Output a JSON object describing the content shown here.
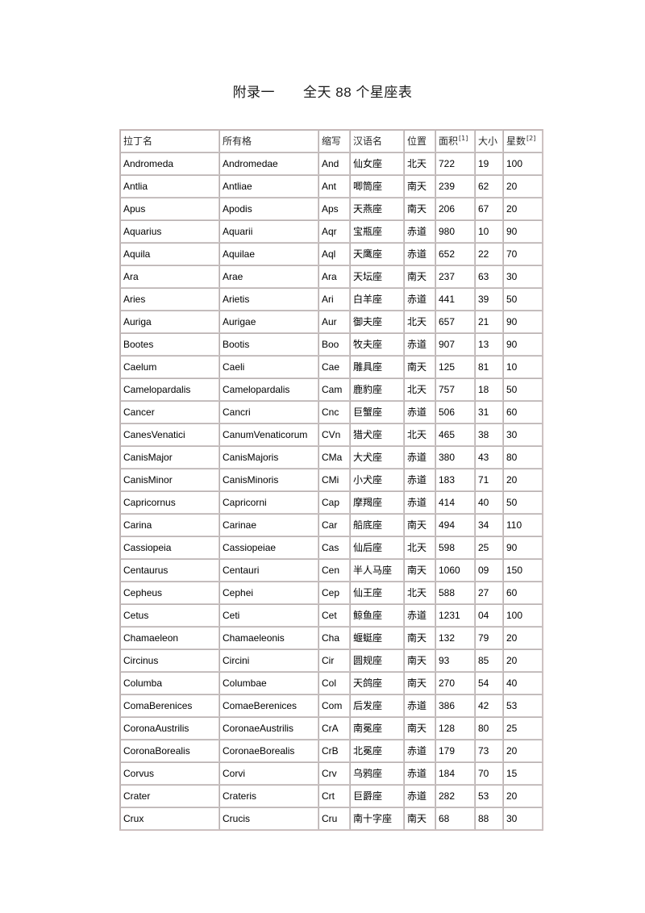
{
  "document": {
    "title": "附录一　　全天 88 个星座表",
    "page_background": "#ffffff",
    "border_color": "#b9b2b2"
  },
  "table": {
    "name": "全天88个星座表",
    "headers": [
      {
        "label": "拉丁名",
        "footnote": ""
      },
      {
        "label": "所有格",
        "footnote": ""
      },
      {
        "label": "缩写",
        "footnote": ""
      },
      {
        "label": "汉语名",
        "footnote": ""
      },
      {
        "label": "位置",
        "footnote": ""
      },
      {
        "label": "面积",
        "footnote": "[1]"
      },
      {
        "label": "大小",
        "footnote": ""
      },
      {
        "label": "星数",
        "footnote": "[2]"
      }
    ],
    "rows": [
      [
        "Andromeda",
        "Andromedae",
        "And",
        "仙女座",
        "北天",
        "722",
        "19",
        "100"
      ],
      [
        "Antlia",
        "Antliae",
        "Ant",
        "唧筒座",
        "南天",
        "239",
        "62",
        "20"
      ],
      [
        "Apus",
        "Apodis",
        "Aps",
        "天燕座",
        "南天",
        "206",
        "67",
        "20"
      ],
      [
        "Aquarius",
        "Aquarii",
        "Aqr",
        "宝瓶座",
        "赤道",
        "980",
        "10",
        "90"
      ],
      [
        "Aquila",
        "Aquilae",
        "Aql",
        "天鹰座",
        "赤道",
        "652",
        "22",
        "70"
      ],
      [
        "Ara",
        "Arae",
        "Ara",
        "天坛座",
        "南天",
        "237",
        "63",
        "30"
      ],
      [
        "Aries",
        "Arietis",
        "Ari",
        "白羊座",
        "赤道",
        "441",
        "39",
        "50"
      ],
      [
        "Auriga",
        "Aurigae",
        "Aur",
        "御夫座",
        "北天",
        "657",
        "21",
        "90"
      ],
      [
        "Bootes",
        "Bootis",
        "Boo",
        "牧夫座",
        "赤道",
        "907",
        "13",
        "90"
      ],
      [
        "Caelum",
        "Caeli",
        "Cae",
        "雕具座",
        "南天",
        "125",
        "81",
        "10"
      ],
      [
        "Camelopardalis",
        "Camelopardalis",
        "Cam",
        "鹿豹座",
        "北天",
        "757",
        "18",
        "50"
      ],
      [
        "Cancer",
        "Cancri",
        "Cnc",
        "巨蟹座",
        "赤道",
        "506",
        "31",
        "60"
      ],
      [
        "CanesVenatici",
        "CanumVenaticorum",
        "CVn",
        "猎犬座",
        "北天",
        "465",
        "38",
        "30"
      ],
      [
        "CanisMajor",
        "CanisMajoris",
        "CMa",
        "大犬座",
        "赤道",
        "380",
        "43",
        "80"
      ],
      [
        "CanisMinor",
        "CanisMinoris",
        "CMi",
        "小犬座",
        "赤道",
        "183",
        "71",
        "20"
      ],
      [
        "Capricornus",
        "Capricorni",
        "Cap",
        "摩羯座",
        "赤道",
        "414",
        "40",
        "50"
      ],
      [
        "Carina",
        "Carinae",
        "Car",
        "船底座",
        "南天",
        "494",
        "34",
        "110"
      ],
      [
        "Cassiopeia",
        "Cassiopeiae",
        "Cas",
        "仙后座",
        "北天",
        "598",
        "25",
        "90"
      ],
      [
        "Centaurus",
        "Centauri",
        "Cen",
        "半人马座",
        "南天",
        "1060",
        "09",
        "150"
      ],
      [
        "Cepheus",
        "Cephei",
        "Cep",
        "仙王座",
        "北天",
        "588",
        "27",
        "60"
      ],
      [
        "Cetus",
        "Ceti",
        "Cet",
        "鲸鱼座",
        "赤道",
        "1231",
        "04",
        "100"
      ],
      [
        "Chamaeleon",
        "Chamaeleonis",
        "Cha",
        "蝘蜓座",
        "南天",
        "132",
        "79",
        "20"
      ],
      [
        "Circinus",
        "Circini",
        "Cir",
        "圆规座",
        "南天",
        "93",
        "85",
        "20"
      ],
      [
        "Columba",
        "Columbae",
        "Col",
        "天鸽座",
        "南天",
        "270",
        "54",
        "40"
      ],
      [
        "ComaBerenices",
        "ComaeBerenices",
        "Com",
        "后发座",
        "赤道",
        "386",
        "42",
        "53"
      ],
      [
        "CoronaAustrilis",
        "CoronaeAustrilis",
        "CrA",
        "南冕座",
        "南天",
        "128",
        "80",
        "25"
      ],
      [
        "CoronaBorealis",
        "CoronaeBorealis",
        "CrB",
        "北冕座",
        "赤道",
        "179",
        "73",
        "20"
      ],
      [
        "Corvus",
        "Corvi",
        "Crv",
        "乌鸦座",
        "赤道",
        "184",
        "70",
        "15"
      ],
      [
        "Crater",
        "Crateris",
        "Crt",
        "巨爵座",
        "赤道",
        "282",
        "53",
        "20"
      ],
      [
        "Crux",
        "Crucis",
        "Cru",
        "南十字座",
        "南天",
        "68",
        "88",
        "30"
      ]
    ]
  }
}
